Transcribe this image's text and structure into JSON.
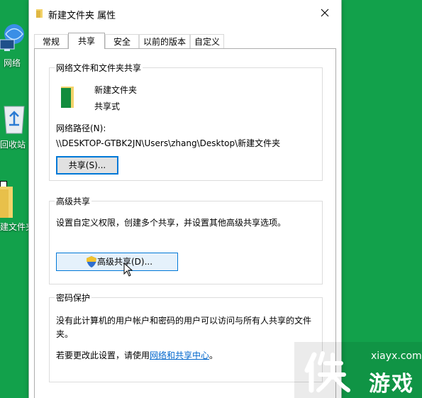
{
  "desktop": {
    "icons": [
      {
        "label": "网络"
      },
      {
        "label": "回收站"
      },
      {
        "label": "建文件夹"
      }
    ]
  },
  "dialog": {
    "title": "新建文件夹 属性",
    "tabs": [
      {
        "label": "常规"
      },
      {
        "label": "共享"
      },
      {
        "label": "安全"
      },
      {
        "label": "以前的版本"
      },
      {
        "label": "自定义"
      }
    ],
    "active_tab": "共享",
    "network_sharing": {
      "group_title": "网络文件和文件夹共享",
      "folder_name": "新建文件夹",
      "share_state": "共享式",
      "path_label": "网络路径(N):",
      "path_value": "\\\\DESKTOP-GTBK2JN\\Users\\zhang\\Desktop\\新建文件夹",
      "share_button": "共享(S)..."
    },
    "advanced_sharing": {
      "group_title": "高级共享",
      "description": "设置自定义权限，创建多个共享，并设置其他高级共享选项。",
      "button": "高级共享(D)..."
    },
    "password_protection": {
      "group_title": "密码保护",
      "description_line1": "没有此计算机的用户帐户和密码的用户可以访问与所有人共享的文件",
      "description_line2": "夹。",
      "change_prefix": "若要更改此设置，请使用",
      "change_link": "网络和共享中心",
      "change_suffix": "。"
    }
  },
  "watermark": {
    "site": "xiayx.com",
    "brand": "游戏"
  },
  "colors": {
    "desktop": "#12a14b",
    "link": "#0066cc",
    "focus_border": "#0078d7"
  }
}
